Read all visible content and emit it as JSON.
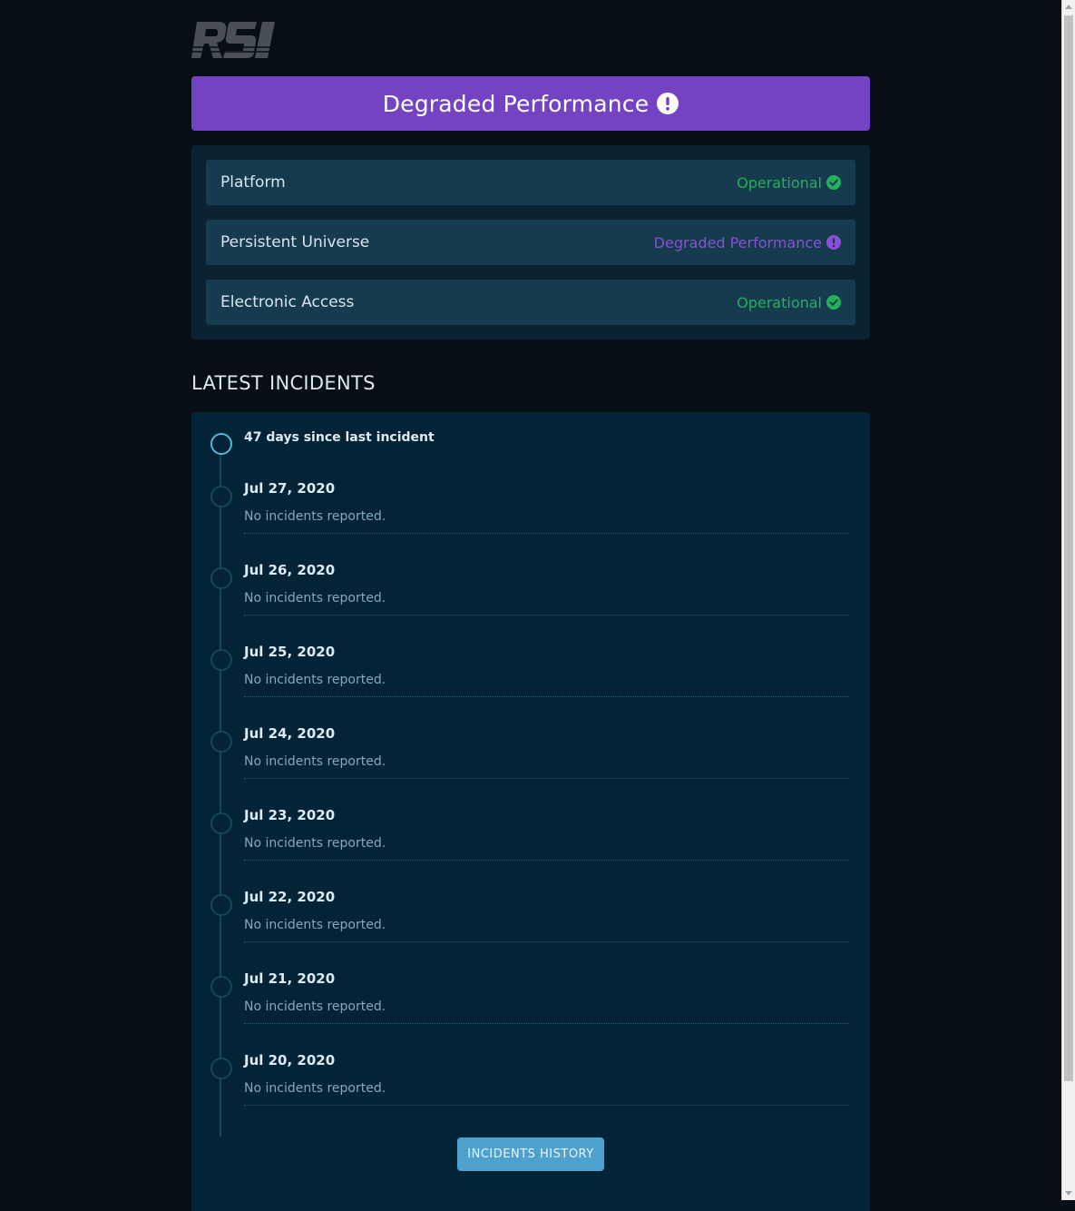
{
  "brand": {
    "logo_text": "RSI",
    "logo_color": "#4a4f55"
  },
  "banner": {
    "text": "Degraded Performance",
    "icon": "exclamation-circle-icon",
    "color": "#7443c4"
  },
  "components": [
    {
      "name": "Platform",
      "status": "Operational",
      "state": "ok",
      "icon": "check-circle-icon"
    },
    {
      "name": "Persistent Universe",
      "status": "Degraded Performance",
      "state": "degraded",
      "icon": "exclamation-circle-icon"
    },
    {
      "name": "Electronic Access",
      "status": "Operational",
      "state": "ok",
      "icon": "check-circle-icon"
    }
  ],
  "colors": {
    "operational": "#23b259",
    "degraded": "#8a4fd6",
    "background": "#060e16",
    "panel": "#0b2233",
    "incident_panel": "#032337",
    "button": "#4fa1cd"
  },
  "incidents": {
    "title": "LATEST INCIDENTS",
    "since": "47 days since last incident",
    "days": [
      {
        "date": "Jul 27, 2020",
        "message": "No incidents reported."
      },
      {
        "date": "Jul 26, 2020",
        "message": "No incidents reported."
      },
      {
        "date": "Jul 25, 2020",
        "message": "No incidents reported."
      },
      {
        "date": "Jul 24, 2020",
        "message": "No incidents reported."
      },
      {
        "date": "Jul 23, 2020",
        "message": "No incidents reported."
      },
      {
        "date": "Jul 22, 2020",
        "message": "No incidents reported."
      },
      {
        "date": "Jul 21, 2020",
        "message": "No incidents reported."
      },
      {
        "date": "Jul 20, 2020",
        "message": "No incidents reported."
      }
    ],
    "history_button": "INCIDENTS HISTORY"
  }
}
